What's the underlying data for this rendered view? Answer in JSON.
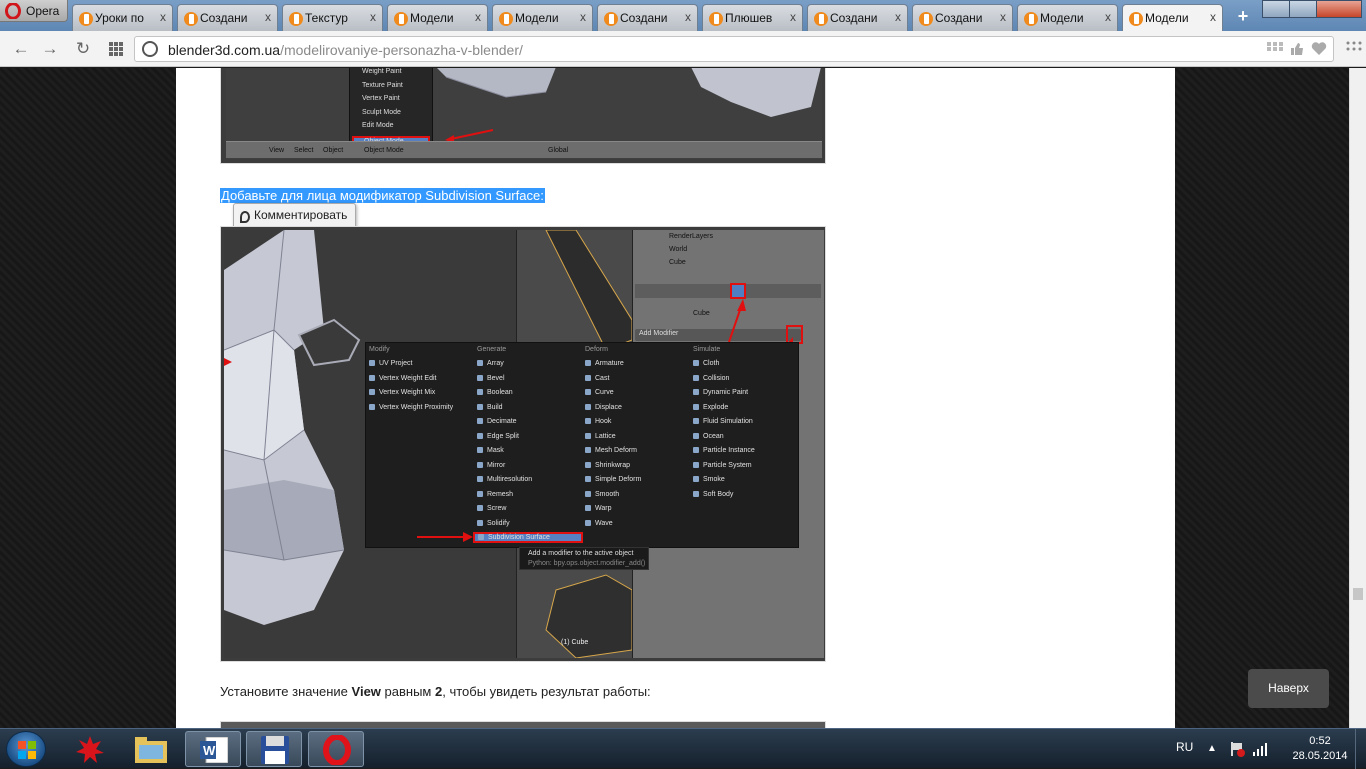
{
  "browser": {
    "menu_label": "Opera",
    "tabs": [
      {
        "title": "Уроки по"
      },
      {
        "title": "Создани"
      },
      {
        "title": "Текстур"
      },
      {
        "title": "Модели"
      },
      {
        "title": "Модели"
      },
      {
        "title": "Создани"
      },
      {
        "title": "Плюшев"
      },
      {
        "title": "Создани"
      },
      {
        "title": "Создани"
      },
      {
        "title": "Модели"
      },
      {
        "title": "Модели",
        "active": true
      }
    ],
    "address": {
      "domain": "blender3d.com.ua",
      "path": "/modelirovaniye-personazha-v-blender/"
    },
    "tab_close_glyph": "x",
    "new_tab_glyph": "+"
  },
  "article": {
    "para1": "Добавьте для лица модификатор Subdivision Surface:",
    "comment_popup": "Комментировать",
    "para2_parts": [
      "Установите значение ",
      "View",
      " равным ",
      "2",
      ", чтобы увидеть результат работы:"
    ],
    "back_to_top": "Наверх"
  },
  "blender_top": {
    "menu_items": [
      "Weight Paint",
      "Texture Paint",
      "Vertex Paint",
      "Sculpt Mode",
      "Edit Mode",
      "Object Mode"
    ],
    "header_items": [
      "View",
      "Select",
      "Object",
      "Object Mode",
      "Global"
    ]
  },
  "blender_modifiers": {
    "outliner": [
      "RenderLayers",
      "World",
      "Cube"
    ],
    "object_name": "Cube",
    "add_modifier": "Add Modifier",
    "columns": [
      {
        "title": "Modify",
        "items": [
          "UV Project",
          "Vertex Weight Edit",
          "Vertex Weight Mix",
          "Vertex Weight Proximity"
        ]
      },
      {
        "title": "Generate",
        "items": [
          "Array",
          "Bevel",
          "Boolean",
          "Build",
          "Decimate",
          "Edge Split",
          "Mask",
          "Mirror",
          "Multiresolution",
          "Remesh",
          "Screw",
          "Solidify",
          "Subdivision Surface"
        ]
      },
      {
        "title": "Deform",
        "items": [
          "Armature",
          "Cast",
          "Curve",
          "Displace",
          "Hook",
          "Lattice",
          "Mesh Deform",
          "Shrinkwrap",
          "Simple Deform",
          "Smooth",
          "Warp",
          "Wave"
        ]
      },
      {
        "title": "Simulate",
        "items": [
          "Cloth",
          "Collision",
          "Dynamic Paint",
          "Explode",
          "Fluid Simulation",
          "Ocean",
          "Particle Instance",
          "Particle System",
          "Smoke",
          "Soft Body"
        ]
      }
    ],
    "tooltip_title": "Add a modifier to the active object",
    "tooltip_python": "Python: bpy.ops.object.modifier_add()",
    "viewport_label": "(1) Cube"
  },
  "taskbar": {
    "language": "RU",
    "time": "0:52",
    "date": "28.05.2014"
  }
}
